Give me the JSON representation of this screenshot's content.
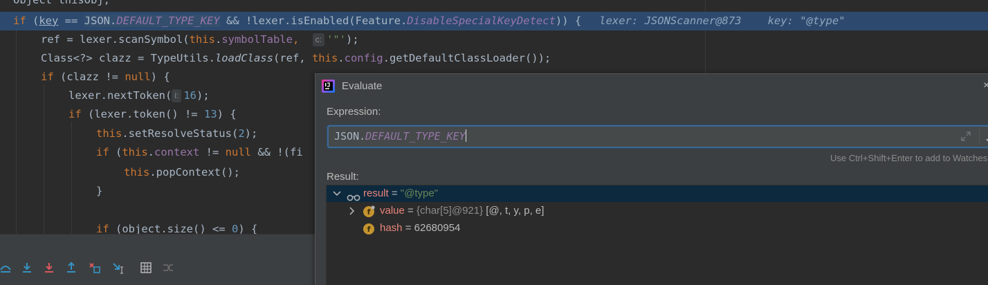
{
  "editor": {
    "line0": "Object thisObj;",
    "line1": {
      "kw_if": "if",
      "open": " (",
      "key": "key",
      "op": " == ",
      "cls": "JSON.",
      "const": "DEFAULT_TYPE_KEY",
      "rest": " && !lexer.isEnabled(Feature.",
      "feature": "DisableSpecialKeyDetect",
      "close": ")) {",
      "inline1": "lexer: JSONScanner@873",
      "inline2": "key: \"@type\""
    },
    "line2": {
      "a": "ref = lexer.scanSymbol(",
      "this": "this",
      "dot": ".",
      "field": "symbolTable",
      "comma": ",",
      "hint": "c:",
      "str": "'\"'",
      "end": ");"
    },
    "line3": {
      "a": "Class<?> clazz = TypeUtils.",
      "method": "loadClass",
      "b": "(ref, ",
      "this": "this",
      "dot": ".",
      "field": "config",
      "c": ".getDefaultClassLoader());"
    },
    "line4": {
      "kw_if": "if",
      "a": " (clazz != ",
      "null": "null",
      "b": ") {"
    },
    "line5": {
      "a": "lexer.nextToken(",
      "hint": "i:",
      "num": "16",
      "b": ");"
    },
    "line6": {
      "kw_if": "if",
      "a": " (lexer.token() != ",
      "num": "13",
      "b": ") {"
    },
    "line7": {
      "this": "this",
      "a": ".setResolveStatus(",
      "num": "2",
      "b": ");"
    },
    "line8": {
      "kw_if": "if",
      "a": " (",
      "this": "this",
      "dot": ".",
      "field": "context",
      "b": " != ",
      "null": "null",
      "c": " && !(fi"
    },
    "line9": {
      "this": "this",
      "a": ".popContext();"
    },
    "line10": "}",
    "line12": {
      "kw_if": "if",
      "a": " (object.size() <= ",
      "num": "0",
      "b": ") {"
    }
  },
  "toolbar": {
    "buttons": [
      "step-over-icon",
      "step-into-icon",
      "force-step-into-icon",
      "step-out-icon",
      "drop-frame-icon",
      "run-to-cursor-icon",
      "evaluate-expression-icon",
      "trace-stream-icon"
    ]
  },
  "evaluate": {
    "title": "Evaluate",
    "close": "×",
    "expression_label": "Expression:",
    "expression_class": "JSON.",
    "expression_const": "DEFAULT_TYPE_KEY",
    "watch_hint": "Use Ctrl+Shift+Enter to add to Watches",
    "result_label": "Result:",
    "tree": [
      {
        "name": "result",
        "eq": " = ",
        "value": "\"@type\""
      },
      {
        "name": "value",
        "eq": " = ",
        "type": "{char[5]@921}",
        "value": " [@, t, y, p, e]"
      },
      {
        "name": "hash",
        "eq": " = ",
        "value": "62680954"
      }
    ]
  },
  "colors": {
    "editor_bg": "#2b2b2b",
    "highlight_line": "#2d4a6e",
    "keyword": "#cc7832",
    "field": "#9876aa",
    "string": "#6a8759",
    "number": "#6897bb",
    "variable_name": "#e8857a"
  }
}
